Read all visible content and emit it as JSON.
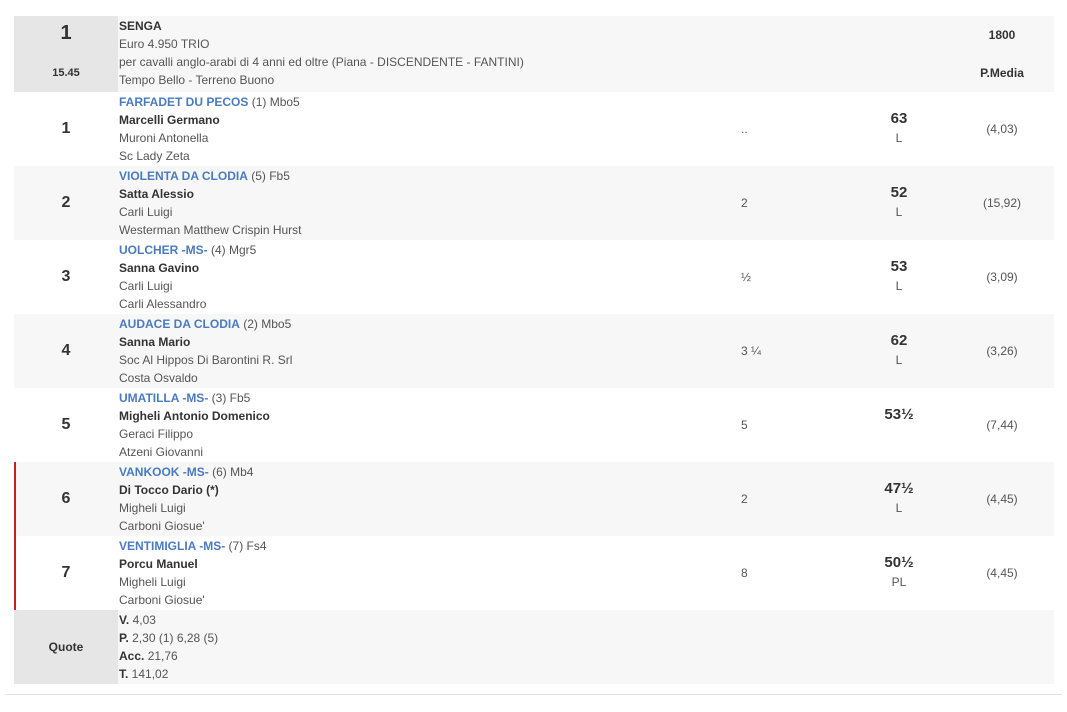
{
  "race": {
    "number": "1",
    "time": "15.45",
    "name": "SENGA",
    "prize": "Euro 4.950 TRIO",
    "conditions": "per cavalli anglo-arabi di 4 anni ed oltre (Piana -  DISCENDENTE  - FANTINI)",
    "weather": "Tempo Bello - Terreno Buono",
    "distance": "1800",
    "type": "P.Media"
  },
  "runners": [
    {
      "pos": "1",
      "horse": "FARFADET DU PECOS",
      "extra": " (1) Mbo5",
      "jockey": "Marcelli Germano",
      "trainer": "Muroni Antonella",
      "owner": "Sc Lady Zeta",
      "margin": "..",
      "weight": "63",
      "weight_note": "L",
      "odds": "(4,03)",
      "marked": false
    },
    {
      "pos": "2",
      "horse": "VIOLENTA DA CLODIA",
      "extra": " (5) Fb5",
      "jockey": "Satta Alessio",
      "trainer": "Carli Luigi",
      "owner": "Westerman Matthew Crispin Hurst",
      "margin": "2",
      "weight": "52",
      "weight_note": "L",
      "odds": "(15,92)",
      "marked": false
    },
    {
      "pos": "3",
      "horse": "UOLCHER -MS-",
      "extra": " (4) Mgr5",
      "jockey": "Sanna Gavino",
      "trainer": "Carli Luigi",
      "owner": "Carli Alessandro",
      "margin": "½",
      "weight": "53",
      "weight_note": "L",
      "odds": "(3,09)",
      "marked": false
    },
    {
      "pos": "4",
      "horse": "AUDACE DA CLODIA",
      "extra": " (2) Mbo5",
      "jockey": "Sanna Mario",
      "trainer": "Soc Al Hippos Di Barontini R. Srl",
      "owner": "Costa Osvaldo",
      "margin": "3 ¼",
      "weight": "62",
      "weight_note": "L",
      "odds": "(3,26)",
      "marked": false
    },
    {
      "pos": "5",
      "horse": "UMATILLA -MS-",
      "extra": " (3) Fb5",
      "jockey": "Migheli Antonio Domenico",
      "trainer": "Geraci Filippo",
      "owner": "Atzeni Giovanni",
      "margin": "5",
      "weight": "53½",
      "weight_note": "",
      "odds": "(7,44)",
      "marked": false
    },
    {
      "pos": "6",
      "horse": "VANKOOK -MS-",
      "extra": " (6) Mb4",
      "jockey": "Di Tocco Dario (*)",
      "trainer": "Migheli Luigi",
      "owner": "Carboni Giosue'",
      "margin": "2",
      "weight": "47½",
      "weight_note": "L",
      "odds": "(4,45)",
      "marked": true
    },
    {
      "pos": "7",
      "horse": "VENTIMIGLIA -MS-",
      "extra": " (7) Fs4",
      "jockey": "Porcu Manuel",
      "trainer": "Migheli Luigi",
      "owner": "Carboni Giosue'",
      "margin": "8",
      "weight": "50½",
      "weight_note": "PL",
      "odds": "(4,45)",
      "marked": true
    }
  ],
  "quote": {
    "label": "Quote",
    "lines": [
      {
        "key": "V.",
        "value": " 4,03"
      },
      {
        "key": "P.",
        "value": " 2,30 (1)  6,28 (5)"
      },
      {
        "key": "Acc.",
        "value": " 21,76"
      },
      {
        "key": "T.",
        "value": " 141,02"
      }
    ]
  }
}
